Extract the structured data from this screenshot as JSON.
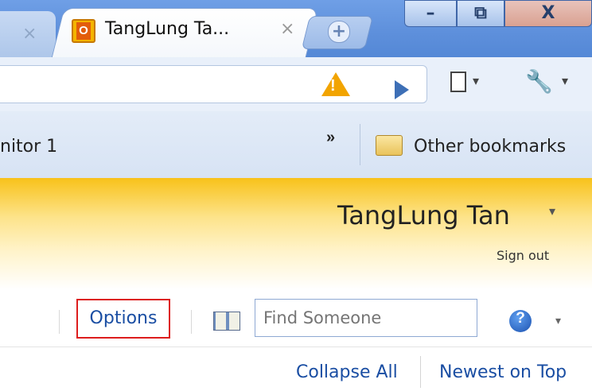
{
  "browser": {
    "inactive_tab_close": "×",
    "active_tab": {
      "title": "TangLung Ta...",
      "close": "×",
      "icon_letter": "O"
    },
    "new_tab": "+",
    "window_buttons": {
      "minimize": "–",
      "maximize": "⧉",
      "close": "X"
    }
  },
  "toolbar": {
    "warning_mark": "!",
    "page_menu_caret": "▾",
    "wrench_menu_caret": "▾"
  },
  "bookmarks": {
    "partial_item": "nitor 1",
    "overflow": "»",
    "other_bookmarks": "Other bookmarks"
  },
  "account": {
    "name": "TangLung Tan",
    "caret": "▾",
    "sign_out": "Sign out"
  },
  "commands": {
    "options": "Options",
    "find_someone_placeholder": "Find Someone",
    "help_glyph": "?",
    "help_caret": "▾"
  },
  "view": {
    "collapse_all": "Collapse All",
    "newest_on_top": "Newest on Top"
  },
  "colors": {
    "link": "#1a4ea3",
    "highlight_box": "#dd1d1d",
    "banner_yellow": "#f8c21a",
    "warning": "#f2a400"
  }
}
